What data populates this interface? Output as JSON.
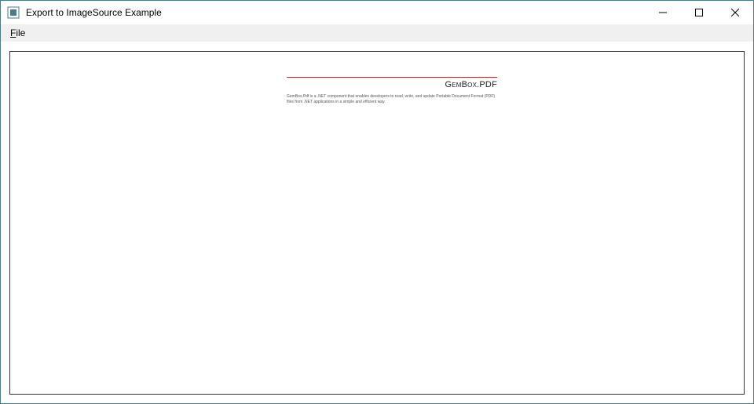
{
  "window": {
    "title": "Export to ImageSource Example"
  },
  "menu": {
    "file_label": "File",
    "file_mnemonic": "F"
  },
  "document": {
    "heading": "GemBox.PDF",
    "body": "GemBox.Pdf is a .NET component that enables developers to read, write, and update Portable Document Format (PDF) files from .NET applications in a simple and efficient way."
  }
}
